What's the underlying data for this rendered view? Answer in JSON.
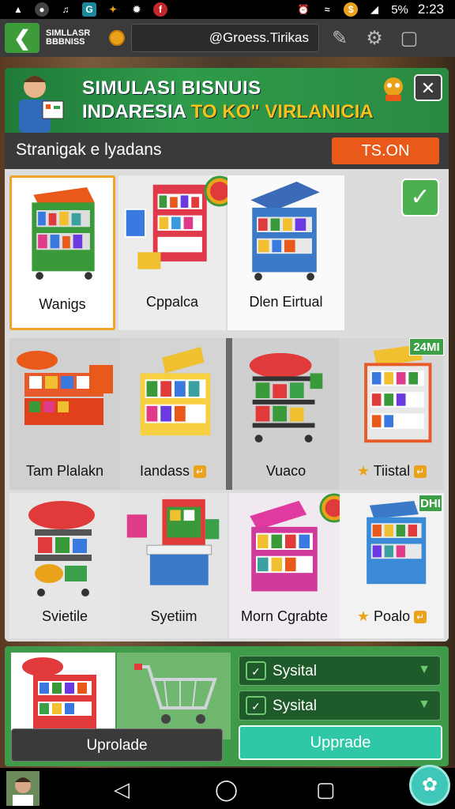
{
  "status_bar": {
    "battery": "5%",
    "time": "2:23",
    "icons": [
      "torch-icon",
      "messenger-icon",
      "music-icon",
      "phone-icon",
      "game-icon",
      "settings-icon",
      "flipboard-icon",
      "alarm-icon",
      "wifi-icon",
      "coin-icon",
      "signal-icon"
    ]
  },
  "top_bar": {
    "app_name_line1": "SIMLLASR",
    "app_name_line2": "BBBNISS",
    "handle": "@Groess.Tirikas"
  },
  "banner": {
    "title_line1": "SIMULASI BISNUIS",
    "title_line2_white": "INDARESIA",
    "title_line2_accent": "TO KO\" VIRLANICIA",
    "close": "✕"
  },
  "subbar": {
    "title": "Stranigak e lyadans",
    "button": "TS.ON"
  },
  "tiles": [
    {
      "label": "Wanigs"
    },
    {
      "label": "Cppalca"
    },
    {
      "label": "Dlen Eirtual"
    },
    {
      "label": "Tam Plalakn"
    },
    {
      "label": "Iandass"
    },
    {
      "label": "Vuaco"
    },
    {
      "label": "Tiistal"
    },
    {
      "label": "Svietile"
    },
    {
      "label": "Syetiim"
    },
    {
      "label": "Morn Cgrabte"
    },
    {
      "label": "Poalo"
    }
  ],
  "price_tags": {
    "tag1": "24MI",
    "tag2": "DHI"
  },
  "bottom": {
    "upload_label": "Uprolade",
    "upgrade_label": "Upprade",
    "select1": "Sysital",
    "select2": "Sysital"
  },
  "colors": {
    "accent_green": "#3f9a4a",
    "accent_orange": "#e9591a",
    "teal": "#2fc8a6"
  }
}
